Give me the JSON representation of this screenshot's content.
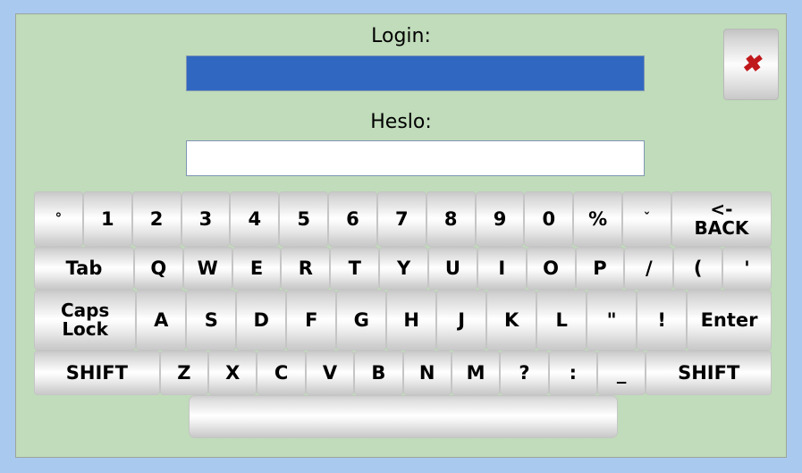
{
  "window": {
    "frame_color": "#a9c9ef",
    "panel_color": "#c0dcba"
  },
  "form": {
    "login_label": "Login:",
    "login_value": "",
    "login_field_state": "selected",
    "login_field_color": "#3067c0",
    "password_label": "Heslo:",
    "password_value": "",
    "password_field_color": "#ffffff"
  },
  "close_button": {
    "name": "close-button",
    "glyph": "✖",
    "color": "#c0191c"
  },
  "keyboard": {
    "rows": [
      {
        "id": "row-numbers",
        "keys": [
          {
            "label": "°",
            "name": "key-degree",
            "style": "small-glyph"
          },
          {
            "label": "1",
            "name": "key-1"
          },
          {
            "label": "2",
            "name": "key-2"
          },
          {
            "label": "3",
            "name": "key-3"
          },
          {
            "label": "4",
            "name": "key-4"
          },
          {
            "label": "5",
            "name": "key-5"
          },
          {
            "label": "6",
            "name": "key-6"
          },
          {
            "label": "7",
            "name": "key-7"
          },
          {
            "label": "8",
            "name": "key-8"
          },
          {
            "label": "9",
            "name": "key-9"
          },
          {
            "label": "0",
            "name": "key-0"
          },
          {
            "label": "%",
            "name": "key-percent"
          },
          {
            "label": "ˇ",
            "name": "key-caron",
            "style": "small-glyph"
          },
          {
            "label": "<-\nBACK",
            "name": "key-backspace",
            "style": "two-line",
            "width": "wide-2"
          }
        ]
      },
      {
        "id": "row-top-letters",
        "keys": [
          {
            "label": "Tab",
            "name": "key-tab",
            "width": "wide-2"
          },
          {
            "label": "Q",
            "name": "key-q"
          },
          {
            "label": "W",
            "name": "key-w"
          },
          {
            "label": "E",
            "name": "key-e"
          },
          {
            "label": "R",
            "name": "key-r"
          },
          {
            "label": "T",
            "name": "key-t"
          },
          {
            "label": "Y",
            "name": "key-y"
          },
          {
            "label": "U",
            "name": "key-u"
          },
          {
            "label": "I",
            "name": "key-i"
          },
          {
            "label": "O",
            "name": "key-o"
          },
          {
            "label": "P",
            "name": "key-p"
          },
          {
            "label": "/",
            "name": "key-slash"
          },
          {
            "label": "(",
            "name": "key-paren-open"
          },
          {
            "label": "'",
            "name": "key-apostrophe"
          }
        ]
      },
      {
        "id": "row-home-letters",
        "keys": [
          {
            "label": "Caps\nLock",
            "name": "key-caps-lock",
            "style": "two-line",
            "width": "wide-2"
          },
          {
            "label": "A",
            "name": "key-a"
          },
          {
            "label": "S",
            "name": "key-s"
          },
          {
            "label": "D",
            "name": "key-d"
          },
          {
            "label": "F",
            "name": "key-f"
          },
          {
            "label": "G",
            "name": "key-g"
          },
          {
            "label": "H",
            "name": "key-h"
          },
          {
            "label": "J",
            "name": "key-j"
          },
          {
            "label": "K",
            "name": "key-k"
          },
          {
            "label": "L",
            "name": "key-l"
          },
          {
            "label": "\"",
            "name": "key-quote"
          },
          {
            "label": "!",
            "name": "key-exclamation"
          },
          {
            "label": "Enter",
            "name": "key-enter",
            "width": "wide-enter"
          }
        ]
      },
      {
        "id": "row-bottom-letters",
        "keys": [
          {
            "label": "SHIFT",
            "name": "key-shift-left",
            "width": "wide-shift"
          },
          {
            "label": "Z",
            "name": "key-z"
          },
          {
            "label": "X",
            "name": "key-x"
          },
          {
            "label": "C",
            "name": "key-c"
          },
          {
            "label": "V",
            "name": "key-v"
          },
          {
            "label": "B",
            "name": "key-b"
          },
          {
            "label": "N",
            "name": "key-n"
          },
          {
            "label": "M",
            "name": "key-m"
          },
          {
            "label": "?",
            "name": "key-question"
          },
          {
            "label": ":",
            "name": "key-colon"
          },
          {
            "label": "_",
            "name": "key-underscore"
          },
          {
            "label": "SHIFT",
            "name": "key-shift-right",
            "width": "wide-shift"
          }
        ]
      }
    ],
    "spacebar": {
      "label": "",
      "name": "key-space"
    }
  }
}
